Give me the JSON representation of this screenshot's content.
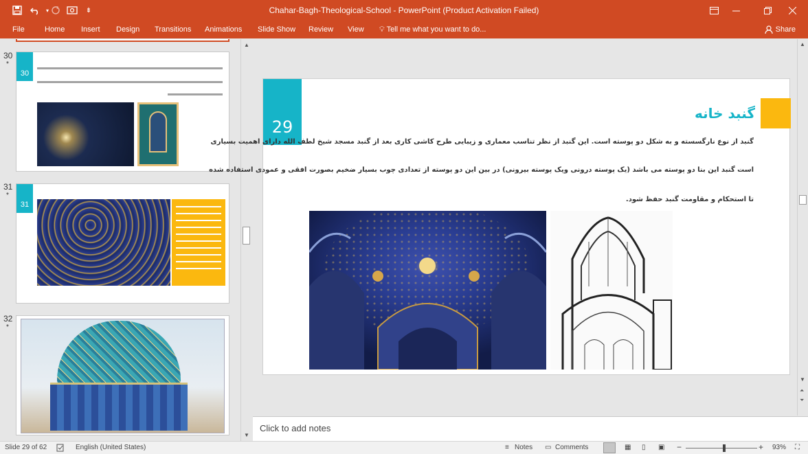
{
  "app": {
    "window_title": "Chahar-Bagh-Theological-School - PowerPoint (Product Activation Failed)"
  },
  "ribbon": {
    "tabs": [
      "File",
      "Home",
      "Insert",
      "Design",
      "Transitions",
      "Animations",
      "Slide Show",
      "Review",
      "View"
    ],
    "tell_me": "Tell me what you want to do...",
    "share": "Share"
  },
  "thumbnails": [
    {
      "number": "30",
      "star": "*",
      "badge": "30"
    },
    {
      "number": "31",
      "star": "*",
      "badge": "31"
    },
    {
      "number": "32",
      "star": "*"
    }
  ],
  "slide": {
    "number": "29",
    "title": "گنبد خانه",
    "lines": [
      "گنبد از نوع نارگسسته و به شکل دو پوسته است. این گنبد از نظر تناسب معماری و زیبایی طرح کاشی کاری بعد از گنبد مسجد شیخ لطف الله دارای اهمیت بسیاری",
      "است گنبد این بنا دو پوسته می باشد (یک پوسته درونی ویک پوسته بیرونی) در بین این دو پوسته از تعدادی چوب بسیار ضخیم بصورت افقی و عمودی استفاده شده",
      "تا استحکام و مقاومت گنبد حفظ شود."
    ],
    "colors": {
      "accent_teal": "#16b4c8",
      "accent_yellow": "#fbb80f"
    }
  },
  "notes_placeholder": "Click to add notes",
  "statusbar": {
    "slide_info": "Slide 29 of 62",
    "language": "English (United States)",
    "notes_label": "Notes",
    "comments_label": "Comments",
    "zoom": "93%"
  }
}
